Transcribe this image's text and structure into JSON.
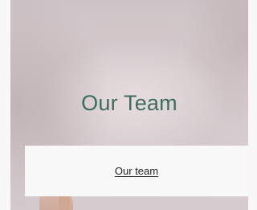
{
  "hero": {
    "title": "Our Team"
  },
  "caption": {
    "link_text": "Our team"
  },
  "colors": {
    "title": "#3f6b61",
    "panel_background": "#f8f8f8",
    "link": "#222222"
  }
}
